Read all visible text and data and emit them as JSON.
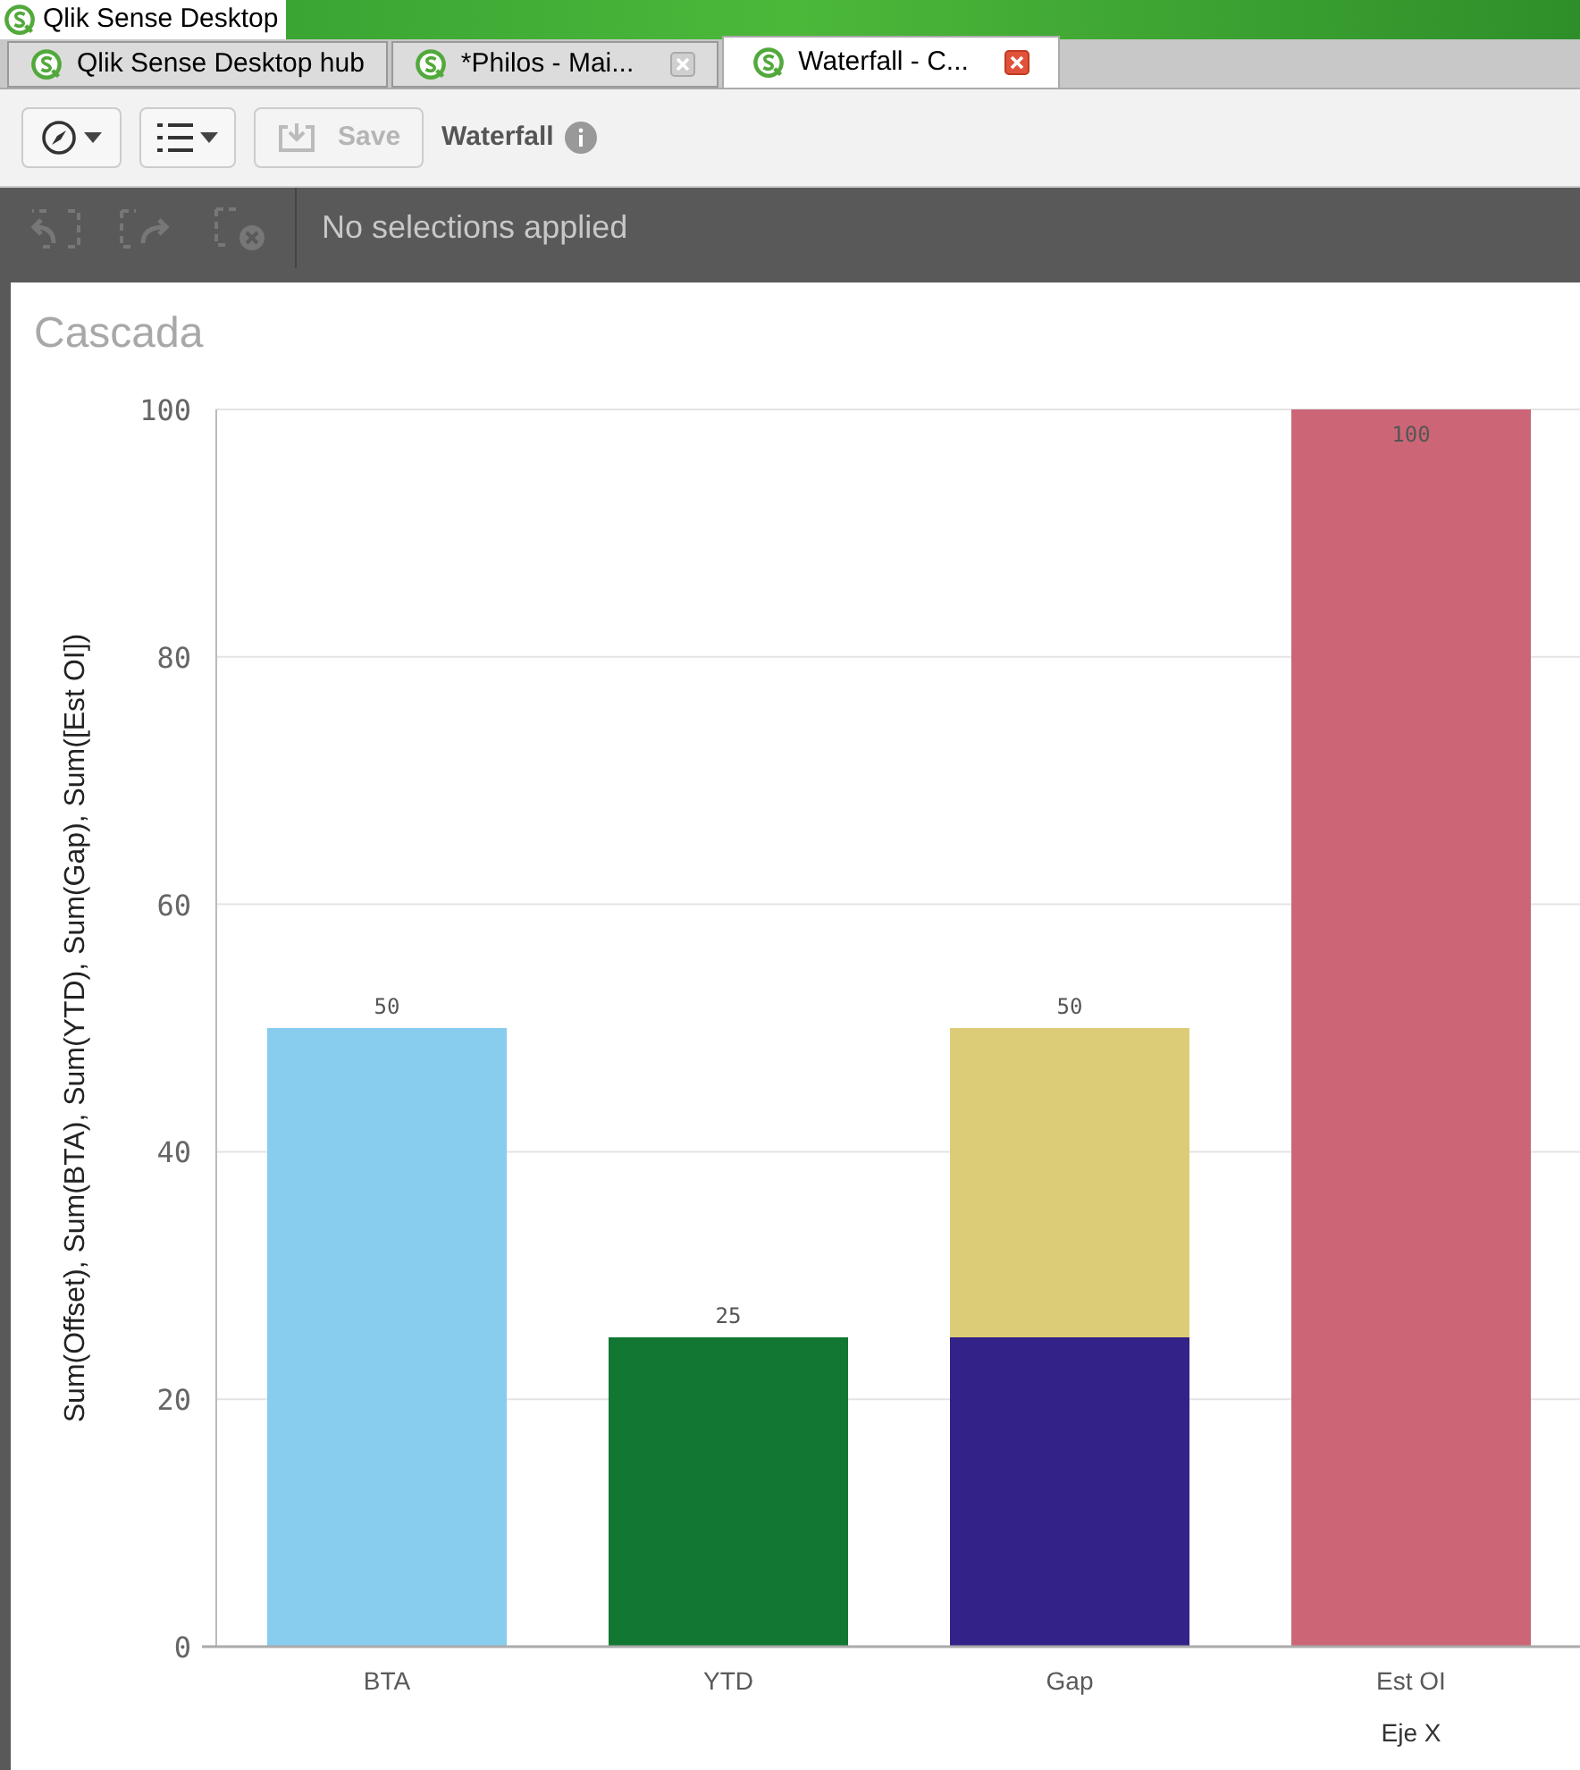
{
  "window": {
    "title": "Qlik Sense Desktop"
  },
  "tabs": [
    {
      "label": "Qlik Sense Desktop hub",
      "selected": false,
      "closable": false
    },
    {
      "label": "*Philos - Mai...",
      "selected": false,
      "closable": true
    },
    {
      "label": "Waterfall - C...",
      "selected": true,
      "closable": true
    }
  ],
  "toolbar": {
    "save": {
      "label": "Save",
      "disabled": true
    },
    "sheet_title": "Waterfall"
  },
  "selections": {
    "text": "No selections applied",
    "tools_disabled": true
  },
  "chart": {
    "title": "Cascada",
    "chart_data": {
      "type": "bar",
      "stacked": true,
      "grid": true,
      "xlabel": "Eje X",
      "ylabel": "Sum(Offset), Sum(BTA), Sum(YTD), Sum(Gap), Sum([Est OI])",
      "categories": [
        "BTA",
        "YTD",
        "Gap",
        "Est OI"
      ],
      "series": [
        {
          "color": "#332288",
          "values": [
            null,
            null,
            25,
            null
          ]
        },
        {
          "color": "#88ccee",
          "values": [
            50,
            null,
            null,
            null
          ]
        },
        {
          "color": "#117733",
          "values": [
            null,
            25,
            null,
            null
          ]
        },
        {
          "color": "#ddcc77",
          "values": [
            null,
            null,
            25,
            null
          ]
        },
        {
          "color": "#cc6677",
          "values": [
            null,
            null,
            null,
            100
          ]
        }
      ],
      "ylim": [
        0,
        100
      ],
      "yticks": [
        0,
        20,
        40,
        60,
        80,
        100
      ],
      "value_labels": [
        "50",
        "25",
        "50",
        "100"
      ]
    }
  }
}
